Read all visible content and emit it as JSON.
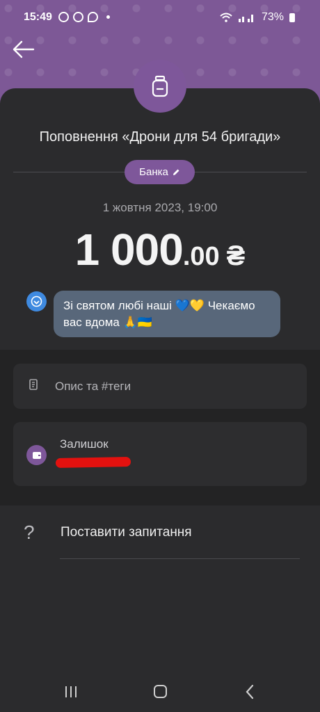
{
  "status_bar": {
    "time": "15:49",
    "battery": "73%"
  },
  "header": {
    "back_icon": "arrow-left-icon",
    "jar_icon": "jar-icon"
  },
  "transaction": {
    "title": "Поповнення «Дрони для 54 бригади»",
    "category_chip": "Банка",
    "date": "1 жовтня 2023, 19:00",
    "amount_integer": "1 000",
    "amount_decimal": ".00",
    "currency": "₴",
    "comment": "Зі святом любі наші 💙💛 Чекаємо вас вдома 🙏🇺🇦"
  },
  "details": {
    "description_label": "Опис та #теги",
    "balance_label": "Залишок"
  },
  "help": {
    "ask_label": "Поставити запитання",
    "icon": "?"
  },
  "colors": {
    "accent": "#7e579a",
    "background": "#2b2b2d",
    "comment_bubble": "#58677a",
    "redaction": "#e3110f"
  }
}
